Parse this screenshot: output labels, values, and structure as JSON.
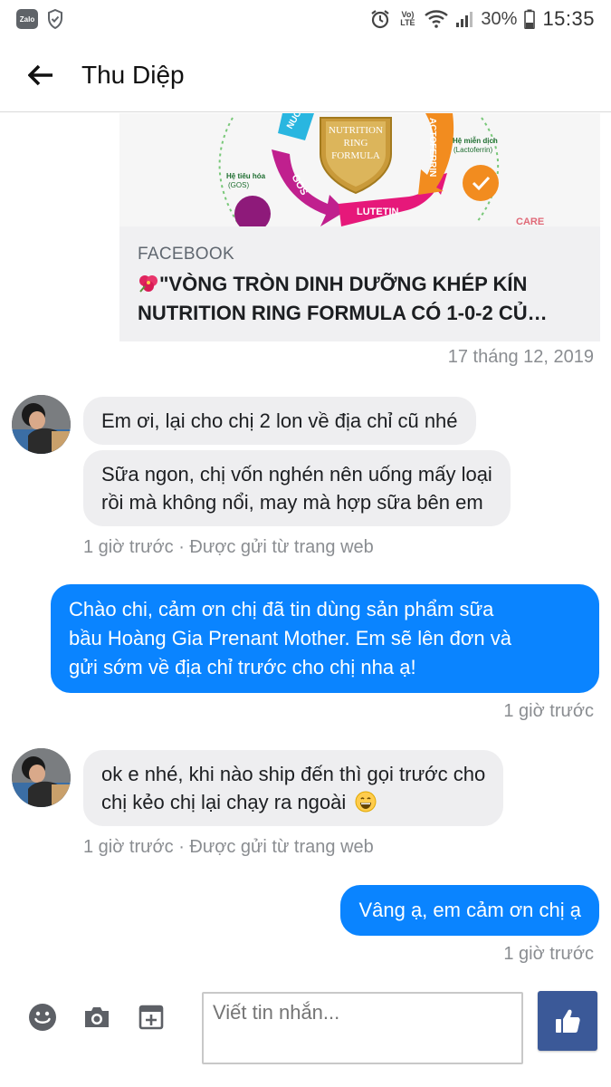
{
  "status_bar": {
    "left_app": "Zalo",
    "network_label": "Vo) LTE",
    "battery": "30%",
    "time": "15:35"
  },
  "header": {
    "title": "Thu Diệp"
  },
  "link_card": {
    "source": "FACEBOOK",
    "title_line1": "\"VÒNG TRÒN DINH DƯỠNG KHÉP KÍN",
    "title_line2": "NUTRITION RING FORMULA CÓ 1-0-2 CỦ…",
    "image_text": {
      "center_line1": "NUTRITION",
      "center_line2": "RING",
      "center_line3": "FORMULA",
      "nuc": "NUC",
      "gos": "GOS",
      "lutetin": "LUTETIN",
      "lactoferrin": "ACTOFERRIN",
      "digest_line1": "Hệ tiêu hóa",
      "digest_line2": "(GOS)",
      "immune_line1": "Hệ miễn dịch",
      "immune_line2": "(Lactoferrin)",
      "brand": "CARE"
    }
  },
  "date_separator": "17 tháng 12, 2019",
  "messages": {
    "in1_a": "Em ơi, lại cho chị 2 lon về địa chỉ cũ nhé",
    "in1_b_line1": "Sữa ngon, chị vốn nghén nên uống mấy loại",
    "in1_b_line2": "rồi mà không nổi, may mà hợp sữa bên em",
    "in1_meta": "1 giờ trước · Được gửi từ trang web",
    "out1_line1": "Chào chi,  cảm ơn chị đã tin dùng sản phẩm sữa",
    "out1_line2": "bầu Hoàng Gia Prenant Mother. Em sẽ lên đơn và",
    "out1_line3": "gửi sớm về địa chỉ trước cho chị nha ạ!",
    "out1_meta": "1 giờ trước",
    "in2_line1": "ok e nhé, khi nào ship đến thì gọi trước cho",
    "in2_line2": "chị kẻo chị lại chạy ra ngoài",
    "in2_meta": "1 giờ trước · Được gửi từ trang web",
    "out2": "Vâng ạ, em cảm ơn chị ạ",
    "out2_meta": "1 giờ trước"
  },
  "composer": {
    "placeholder": "Viết tin nhắn..."
  },
  "colors": {
    "outgoing_bubble": "#0a84ff",
    "incoming_bubble": "#eeeef0",
    "like_button": "#3b5998"
  }
}
